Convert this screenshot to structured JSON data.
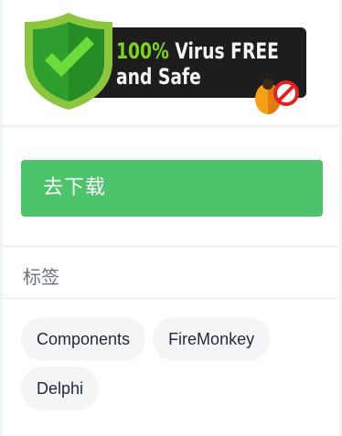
{
  "badge": {
    "line1_highlight": "100%",
    "line1_rest": " Virus FREE",
    "line2": "and Safe",
    "colors": {
      "shield_outer": "#8cc63f",
      "shield_inner": "#2e9e2e",
      "check": "#6ddc3a",
      "bar": "#1d1d1d",
      "highlight": "#7ed321"
    },
    "icons": [
      "shield-check-icon",
      "bug-forbidden-icon"
    ]
  },
  "download": {
    "label": "去下载",
    "color": "#4dc36b"
  },
  "tags": {
    "title": "标签",
    "items": [
      {
        "label": "Components"
      },
      {
        "label": "FireMonkey"
      },
      {
        "label": "Delphi"
      }
    ]
  }
}
